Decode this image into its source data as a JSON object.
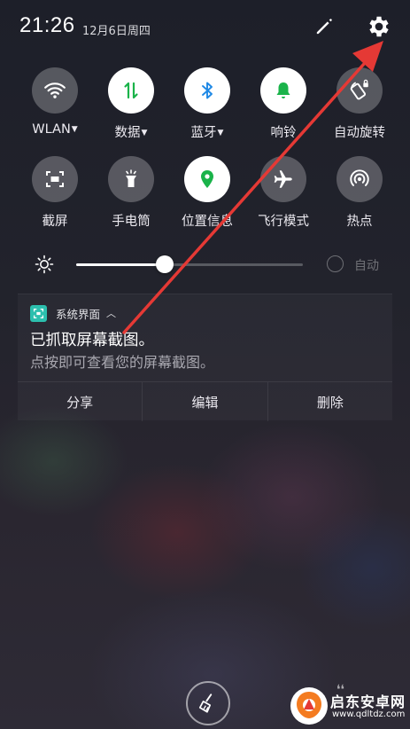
{
  "status_bar": {
    "time": "21:26",
    "date": "12月6日周四",
    "edit_icon": "pencil-icon",
    "settings_icon": "gear-icon"
  },
  "quick_settings": {
    "tiles": [
      {
        "label": "WLAN",
        "icon": "wifi-icon",
        "on": false,
        "dropdown": true
      },
      {
        "label": "数据",
        "icon": "mobile-data-icon",
        "on": true,
        "dropdown": true
      },
      {
        "label": "蓝牙",
        "icon": "bluetooth-icon",
        "on": true,
        "dropdown": true
      },
      {
        "label": "响铃",
        "icon": "bell-icon",
        "on": true,
        "dropdown": false
      },
      {
        "label": "自动旋转",
        "icon": "rotation-lock-icon",
        "on": false,
        "dropdown": false
      },
      {
        "label": "截屏",
        "icon": "screenshot-icon",
        "on": false,
        "dropdown": false
      },
      {
        "label": "手电筒",
        "icon": "flashlight-icon",
        "on": false,
        "dropdown": false
      },
      {
        "label": "位置信息",
        "icon": "location-icon",
        "on": true,
        "dropdown": false
      },
      {
        "label": "飞行模式",
        "icon": "airplane-icon",
        "on": false,
        "dropdown": false
      },
      {
        "label": "热点",
        "icon": "hotspot-icon",
        "on": false,
        "dropdown": false
      }
    ],
    "active_color": "#1ab34a"
  },
  "brightness": {
    "level": 0.39,
    "auto_label": "自动",
    "auto_enabled": false
  },
  "notification": {
    "app_name": "系统界面",
    "title": "已抓取屏幕截图。",
    "text": "点按即可查看您的屏幕截图。",
    "actions": [
      "分享",
      "编辑",
      "删除"
    ],
    "app_icon_color": "#2cbfae"
  },
  "bottom": {
    "clear_icon": "broom-icon"
  },
  "watermark": {
    "title": "启东安卓网",
    "url": "www.qdltdz.com"
  },
  "annotation": {
    "color": "#e53935",
    "points_to": "gear-icon"
  }
}
